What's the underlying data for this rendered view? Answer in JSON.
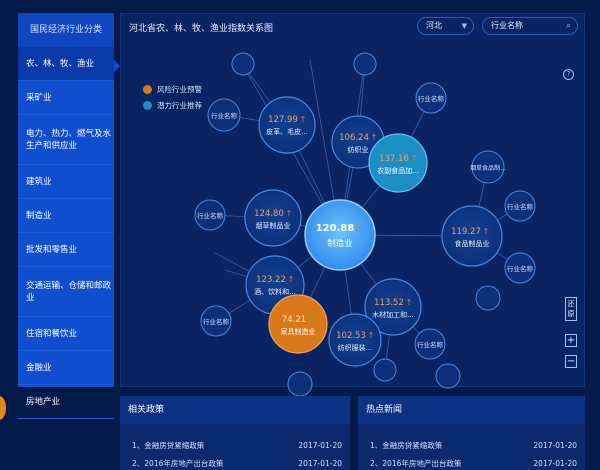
{
  "sidebar": {
    "title": "国民经济行业分类",
    "items": [
      {
        "label": "农、林、牧、渔业"
      },
      {
        "label": "采矿业"
      },
      {
        "label": "电力、热力、燃气及水生产和供应业"
      },
      {
        "label": "建筑业"
      },
      {
        "label": "制造业"
      },
      {
        "label": "批发和零售业"
      },
      {
        "label": "交通运输、仓储和邮政业"
      },
      {
        "label": "住宿和餐饮业"
      },
      {
        "label": "金融业"
      },
      {
        "label": "房地产业"
      }
    ]
  },
  "main": {
    "title": "河北省农、林、牧、渔业指数关系图",
    "region": "河北",
    "search_placeholder": "行业名称",
    "help": "?",
    "legend": [
      {
        "label": "风险行业预警",
        "color": "#d9791a"
      },
      {
        "label": "潜力行业推荐",
        "color": "#1b8fc4"
      }
    ],
    "controls": {
      "reset": "还原",
      "zoom_in": "+",
      "zoom_out": "−"
    }
  },
  "graph": {
    "center": {
      "value": "120.88",
      "label": "制造业"
    },
    "nodes": [
      {
        "value": "127.99",
        "label": "皮革、毛皮..."
      },
      {
        "value": "106.24",
        "label": "纺织业"
      },
      {
        "value": "137.16",
        "label": "农副食品加..."
      },
      {
        "value": "124.80",
        "label": "烟草制品业"
      },
      {
        "value": "119.27",
        "label": "食品制品业"
      },
      {
        "value": "123.22",
        "label": "酒、饮料和..."
      },
      {
        "value": "113.52",
        "label": "木材加工和..."
      },
      {
        "value": "74.21",
        "label": "家具制造业"
      },
      {
        "value": "102.53",
        "label": "纺织服装..."
      }
    ],
    "leaf_label": "行业名称",
    "leaf_label_alt": "烟草食品制..."
  },
  "colors": {
    "risk": "#d9791a",
    "potential": "#1b8fc4",
    "center": "#3a9cf5",
    "node": "#0e3a8c",
    "up_arrow": "#f07a2c",
    "down_arrow": "#34c46a"
  },
  "panels": {
    "policy": {
      "title": "相关政策",
      "rows": [
        {
          "text": "1、金融房贷紧缩政策",
          "date": "2017-01-20"
        },
        {
          "text": "2、2016年房地产出台政策",
          "date": "2017-01-20"
        }
      ]
    },
    "news": {
      "title": "热点新闻",
      "rows": [
        {
          "text": "1、金融房贷紧缩政策",
          "date": "2017-01-20"
        },
        {
          "text": "2、2016年房地产出台政策",
          "date": "2017-01-20"
        }
      ]
    }
  }
}
